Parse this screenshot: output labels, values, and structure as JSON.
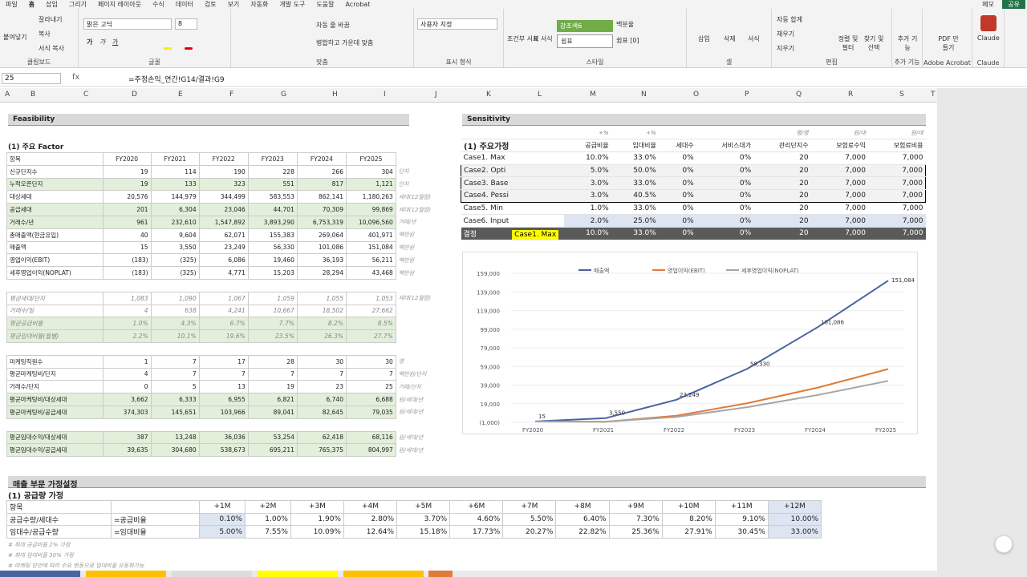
{
  "menu": {
    "tabs": [
      "파일",
      "홈",
      "삽입",
      "그리기",
      "페이지 레이아웃",
      "수식",
      "데이터",
      "검토",
      "보기",
      "자동화",
      "개발 도구",
      "도움말",
      "Acrobat"
    ],
    "memo": "메모",
    "share": "공유"
  },
  "ribbon": {
    "clipboard": {
      "paste": "붙여넣기",
      "cut": "잘라내기",
      "copy": "복사",
      "format": "서식 복사",
      "label": "클립보드"
    },
    "font": {
      "name": "맑은 고딕",
      "size": "8",
      "label": "글꼴",
      "bold": "가",
      "italic": "가",
      "underline": "가"
    },
    "align": {
      "wrap": "자동 줄 바꿈",
      "merge": "병합하고 가운데 맞춤",
      "label": "맞춤"
    },
    "number": {
      "format": "사용자 지정",
      "label": "표시 형식"
    },
    "style": {
      "cond": "조건부 서식",
      "table": "표 서식",
      "s1": "강조색6",
      "s2": "백분율",
      "s3": "쉼표",
      "s4": "쉼표 [0]",
      "label": "스타일"
    },
    "cells": {
      "insert": "삽입",
      "delete": "삭제",
      "format": "서식",
      "label": "셀"
    },
    "edit": {
      "autosum": "자동 합계",
      "fill": "채우기",
      "clear": "지우기",
      "sort": "정렬 및 필터",
      "find": "찾기 및 선택",
      "label": "편집"
    },
    "addins": {
      "more": "추가 기능",
      "label": "추가 기능"
    },
    "adobe": {
      "pdf": "PDF 만들기",
      "label": "Adobe Acrobat"
    },
    "claude": {
      "btn": "Claude",
      "label": "Claude"
    }
  },
  "formula_bar": {
    "name_box": "25",
    "formula": "=주정손익_연간!G14/결과!G9"
  },
  "columns": [
    "A",
    "B",
    "C",
    "D",
    "E",
    "F",
    "G",
    "H",
    "I",
    "J",
    "K",
    "L",
    "M",
    "N",
    "O",
    "P",
    "Q",
    "R",
    "S",
    "T"
  ],
  "feasibility": {
    "title": "Feasibility",
    "subtitle": "(1) 주요 Factor",
    "header": [
      "항목",
      "FY2020",
      "FY2021",
      "FY2022",
      "FY2023",
      "FY2024",
      "FY2025"
    ],
    "rows1": [
      {
        "label": "신규단지수",
        "v": [
          "19",
          "114",
          "190",
          "228",
          "266",
          "304"
        ],
        "u": "단지",
        "g": false
      },
      {
        "label": "누적오픈단지",
        "v": [
          "19",
          "133",
          "323",
          "551",
          "817",
          "1,121"
        ],
        "u": "단지",
        "g": true
      },
      {
        "label": "대상세대",
        "v": [
          "20,576",
          "144,979",
          "344,499",
          "583,553",
          "862,141",
          "1,180,263"
        ],
        "u": "세대(12월말)",
        "g": false
      },
      {
        "label": "공급세대",
        "v": [
          "201",
          "6,304",
          "23,046",
          "44,701",
          "70,309",
          "99,869"
        ],
        "u": "세대(12월말)",
        "g": true
      },
      {
        "label": "거래수/년",
        "v": [
          "961",
          "232,610",
          "1,547,892",
          "3,893,290",
          "6,753,319",
          "10,096,560"
        ],
        "u": "거래/년",
        "g": true
      },
      {
        "label": "총매출액(현금유입)",
        "v": [
          "40",
          "9,604",
          "62,071",
          "155,383",
          "269,064",
          "401,971"
        ],
        "u": "백만원",
        "g": false
      },
      {
        "label": "매출액",
        "v": [
          "15",
          "3,550",
          "23,249",
          "56,330",
          "101,086",
          "151,084"
        ],
        "u": "백만원",
        "g": false
      },
      {
        "label": "영업이익(EBIT)",
        "v": [
          "(183)",
          "(325)",
          "6,086",
          "19,460",
          "36,193",
          "56,211"
        ],
        "u": "백만원",
        "g": false
      },
      {
        "label": "세후영업이익(NOPLAT)",
        "v": [
          "(183)",
          "(325)",
          "4,771",
          "15,203",
          "28,294",
          "43,468"
        ],
        "u": "백만원",
        "g": false
      }
    ],
    "rows2": [
      {
        "label": "평균세대/단지",
        "v": [
          "1,083",
          "1,090",
          "1,067",
          "1,059",
          "1,055",
          "1,053"
        ],
        "u": "세대(12월말)",
        "g": false
      },
      {
        "label": "거래수/일",
        "v": [
          "4",
          "638",
          "4,241",
          "10,667",
          "18,502",
          "27,662"
        ],
        "u": "",
        "g": false
      },
      {
        "label": "평균공급비율",
        "v": [
          "1.0%",
          "4.3%",
          "6.7%",
          "7.7%",
          "8.2%",
          "8.5%"
        ],
        "u": "",
        "g": true
      },
      {
        "label": "평균임대비율(월별)",
        "v": [
          "2.2%",
          "10.1%",
          "19.6%",
          "23.5%",
          "26.3%",
          "27.7%"
        ],
        "u": "",
        "g": true
      }
    ],
    "rows3": [
      {
        "label": "마케팅직원수",
        "v": [
          "1",
          "7",
          "17",
          "28",
          "30",
          "30"
        ],
        "u": "명",
        "g": false
      },
      {
        "label": "평균마케팅비/단지",
        "v": [
          "4",
          "7",
          "7",
          "7",
          "7",
          "7"
        ],
        "u": "백만원/단지",
        "g": false
      },
      {
        "label": "거래수/단지",
        "v": [
          "0",
          "5",
          "13",
          "19",
          "23",
          "25"
        ],
        "u": "거래/단지",
        "g": false
      },
      {
        "label": "평균마케팅비/대상세대",
        "v": [
          "3,662",
          "6,333",
          "6,955",
          "6,821",
          "6,740",
          "6,688"
        ],
        "u": "원/세대/년",
        "g": true
      },
      {
        "label": "평균마케팅비/공급세대",
        "v": [
          "374,303",
          "145,651",
          "103,966",
          "89,041",
          "82,645",
          "79,035"
        ],
        "u": "원/세대/년",
        "g": true
      }
    ],
    "rows4": [
      {
        "label": "평균임대수익/대상세대",
        "v": [
          "387",
          "13,248",
          "36,036",
          "53,254",
          "62,418",
          "68,116"
        ],
        "u": "원/세대/년",
        "g": true
      },
      {
        "label": "평균임대수익/공급세대",
        "v": [
          "39,635",
          "304,680",
          "538,673",
          "695,211",
          "765,375",
          "804,997"
        ],
        "u": "원/세대/년",
        "g": true
      }
    ]
  },
  "sensitivity": {
    "title": "Sensitivity",
    "subtitle": "(1) 주요가정",
    "units": [
      "",
      "+%",
      "+%",
      "",
      "",
      "명/명",
      "원/대",
      "원/대"
    ],
    "header": [
      "",
      "공급비율",
      "임대비율",
      "세대수",
      "서비스대가",
      "관리단지수",
      "보험료수익",
      "보험료비용"
    ],
    "rows": [
      {
        "v": [
          "Case1. Max",
          "10.0%",
          "33.0%",
          "0%",
          "0%",
          "20",
          "7,000",
          "7,000"
        ]
      },
      {
        "v": [
          "Case2. Opti",
          "5.0%",
          "50.0%",
          "0%",
          "0%",
          "20",
          "7,000",
          "7,000"
        ]
      },
      {
        "v": [
          "Case3. Base",
          "3.0%",
          "33.0%",
          "0%",
          "0%",
          "20",
          "7,000",
          "7,000"
        ]
      },
      {
        "v": [
          "Case4. Pessi",
          "3.0%",
          "40.5%",
          "0%",
          "0%",
          "20",
          "7,000",
          "7,000"
        ]
      },
      {
        "v": [
          "Case5. Min",
          "1.0%",
          "33.0%",
          "0%",
          "0%",
          "20",
          "7,000",
          "7,000"
        ]
      },
      {
        "v": [
          "Case6. Input",
          "2.0%",
          "25.0%",
          "0%",
          "0%",
          "20",
          "7,000",
          "7,000"
        ]
      },
      {
        "v": [
          "결정",
          "Case1. Max",
          "10.0%",
          "33.0%",
          "0%",
          "0%",
          "20",
          "7,000",
          "7,000"
        ]
      }
    ]
  },
  "chart_data": {
    "type": "line",
    "categories": [
      "FY2020",
      "FY2021",
      "FY2022",
      "FY2023",
      "FY2024",
      "FY2025"
    ],
    "series": [
      {
        "name": "매출액",
        "values": [
          15,
          3550,
          23249,
          56330,
          101086,
          151084
        ],
        "color": "#4a63a3"
      },
      {
        "name": "영업이익(EBIT)",
        "values": [
          -183,
          -325,
          6086,
          19460,
          36193,
          56211
        ],
        "color": "#e07b39"
      },
      {
        "name": "세후영업이익(NOPLAT)",
        "values": [
          -183,
          -325,
          4771,
          15203,
          28294,
          43468
        ],
        "color": "#a5a5a5"
      }
    ],
    "yticks": [
      "159,000",
      "139,000",
      "119,000",
      "99,000",
      "79,000",
      "59,000",
      "39,000",
      "19,000",
      "(1,000)"
    ],
    "ylim": [
      -1000,
      159000
    ],
    "data_labels": [
      "15",
      "3,550",
      "23,249",
      "58,330",
      "101,086",
      "151,084"
    ]
  },
  "sales": {
    "title": "매출 부문 가정설정",
    "subtitle": "(1) 공급량 가정",
    "header": [
      "항목",
      "",
      "+1M",
      "+2M",
      "+3M",
      "+4M",
      "+5M",
      "+6M",
      "+7M",
      "+8M",
      "+9M",
      "+10M",
      "+11M",
      "+12M"
    ],
    "rows": [
      {
        "v": [
          "공급수량/세대수",
          "=공급비율",
          "0.10%",
          "1.00%",
          "1.90%",
          "2.80%",
          "3.70%",
          "4.60%",
          "5.50%",
          "6.40%",
          "7.30%",
          "8.20%",
          "9.10%",
          "10.00%"
        ]
      },
      {
        "v": [
          "임대수/공급수량",
          "=임대비율",
          "5.00%",
          "7.55%",
          "10.09%",
          "12.64%",
          "15.18%",
          "17.73%",
          "20.27%",
          "22.82%",
          "25.36%",
          "27.91%",
          "30.45%",
          "33.00%"
        ]
      }
    ],
    "notes": [
      "# 최대 공급비율 2% 가정",
      "# 최대 임대비율 30% 가정",
      "# 마케팅 방안에 따라 수요 변동으로 임대비율 유동화가능"
    ]
  }
}
